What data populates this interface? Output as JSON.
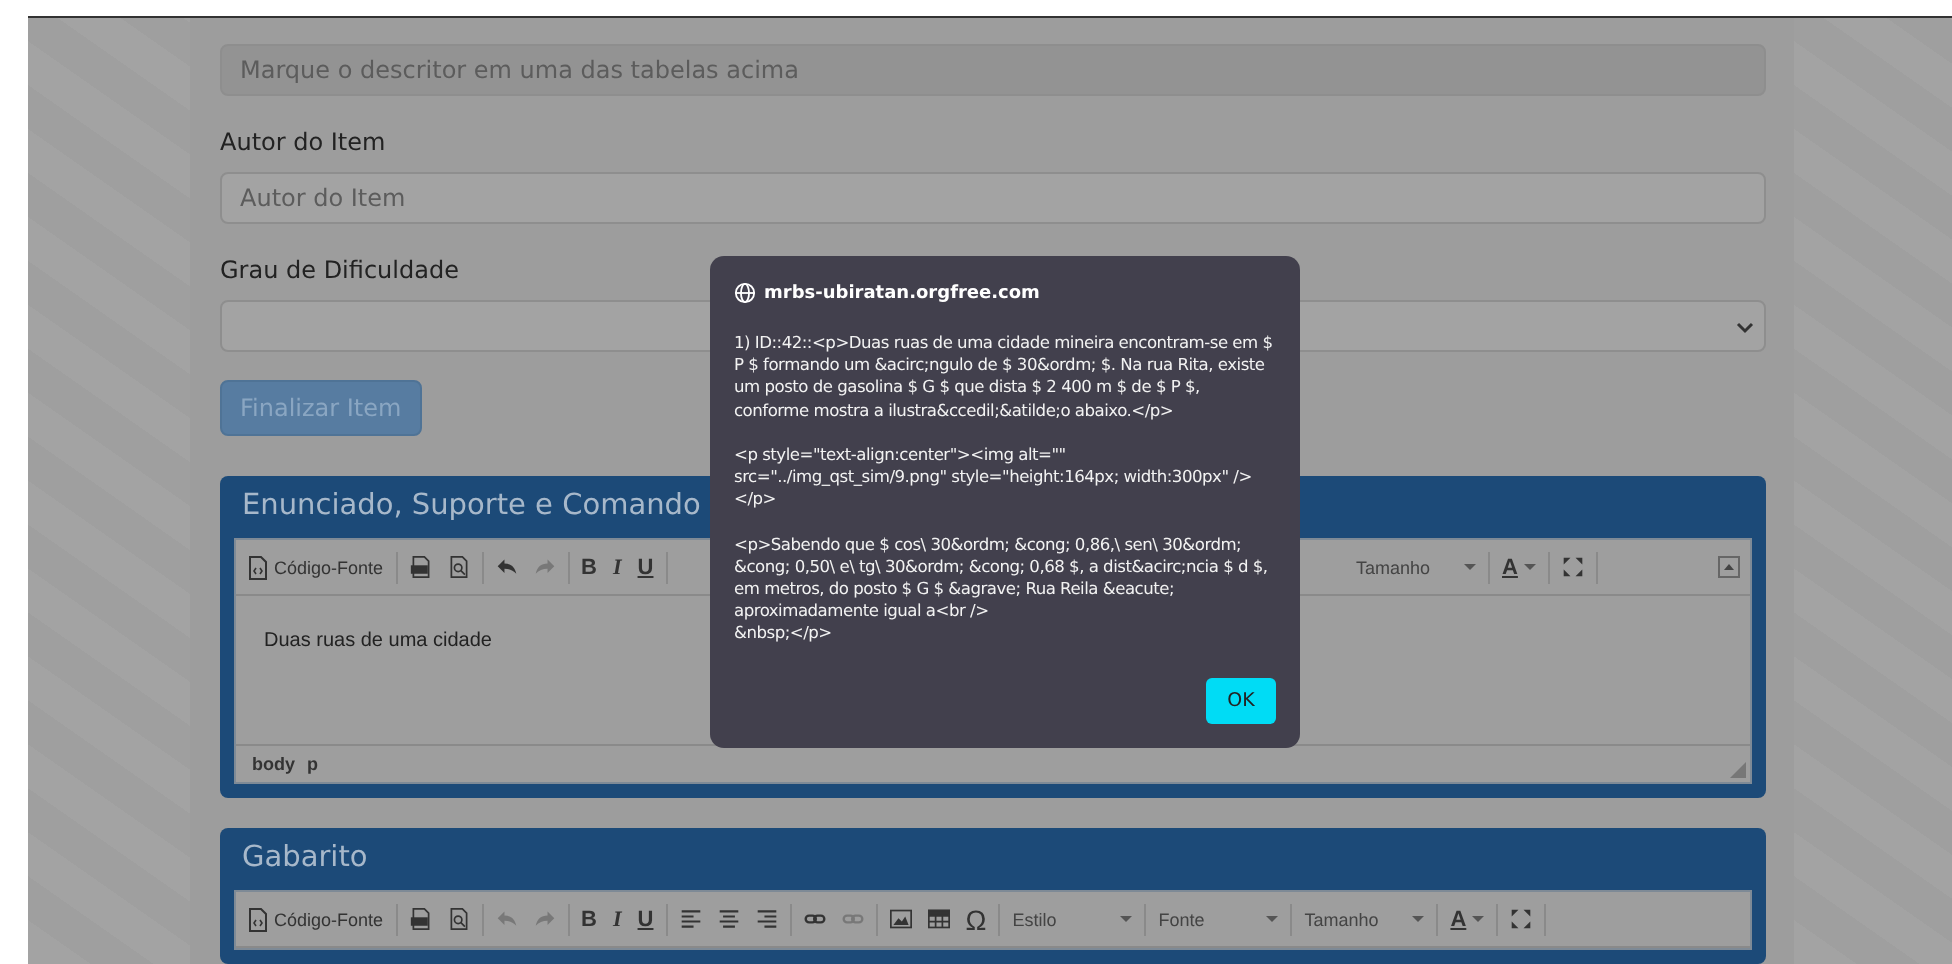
{
  "descriptor_field": {
    "placeholder": "Marque o descritor em uma das tabelas acima",
    "disabled": true
  },
  "author": {
    "label": "Autor do Item",
    "placeholder": "Autor do Item"
  },
  "difficulty": {
    "label": "Grau de Dificuldade"
  },
  "finalize_button": {
    "label": "Finalizar Item"
  },
  "panels": [
    {
      "title": "Enunciado, Suporte e Comando",
      "toolbar": [
        [
          {
            "kind": "source",
            "label": "Código-Fonte",
            "disabled": false
          }
        ],
        [
          {
            "kind": "pdf",
            "disabled": false
          },
          {
            "kind": "preview",
            "disabled": false
          }
        ],
        [
          {
            "kind": "undo",
            "disabled": false
          },
          {
            "kind": "redo",
            "disabled": true
          }
        ],
        [
          {
            "kind": "format",
            "label": "B",
            "disabled": false
          },
          {
            "kind": "format",
            "label": "I",
            "disabled": false
          },
          {
            "kind": "format",
            "label": "U",
            "disabled": false
          }
        ]
      ],
      "toolbar_right": [
        [
          {
            "kind": "dropdown",
            "label": "Tamanho",
            "disabled": false
          }
        ],
        [
          {
            "kind": "color",
            "label": "A",
            "disabled": false
          }
        ],
        [
          {
            "kind": "maximize",
            "disabled": false
          }
        ]
      ],
      "toolbar_collapsed": false,
      "body_text": "Duas ruas de uma cidade",
      "path": [
        "body",
        "p"
      ]
    },
    {
      "title": "Gabarito",
      "toolbar": [
        [
          {
            "kind": "source",
            "label": "Código-Fonte",
            "disabled": false
          }
        ],
        [
          {
            "kind": "pdf",
            "disabled": false
          },
          {
            "kind": "preview",
            "disabled": false
          }
        ],
        [
          {
            "kind": "undo",
            "disabled": true
          },
          {
            "kind": "redo",
            "disabled": true
          }
        ],
        [
          {
            "kind": "format",
            "label": "B",
            "disabled": false
          },
          {
            "kind": "format",
            "label": "I",
            "disabled": false
          },
          {
            "kind": "format",
            "label": "U",
            "disabled": false
          }
        ],
        [
          {
            "kind": "align-left",
            "disabled": false
          },
          {
            "kind": "align-center",
            "disabled": false
          },
          {
            "kind": "align-right",
            "disabled": false
          }
        ],
        [
          {
            "kind": "link",
            "disabled": false
          },
          {
            "kind": "unlink",
            "disabled": true
          }
        ],
        [
          {
            "kind": "image",
            "disabled": false
          },
          {
            "kind": "table",
            "disabled": false
          },
          {
            "kind": "char",
            "label": "Ω",
            "disabled": false
          }
        ],
        [
          {
            "kind": "dropdown",
            "label": "Estilo",
            "disabled": false
          }
        ],
        [
          {
            "kind": "dropdown",
            "label": "Fonte",
            "disabled": false
          }
        ],
        [
          {
            "kind": "dropdown",
            "label": "Tamanho",
            "disabled": false
          }
        ],
        [
          {
            "kind": "color",
            "label": "A",
            "disabled": false
          }
        ],
        [
          {
            "kind": "maximize",
            "disabled": false
          }
        ]
      ]
    }
  ],
  "dialog": {
    "origin": "mrbs-ubiratan.orgfree.com",
    "message": "1) ID::42::<p>Duas ruas de uma cidade mineira encontram-se em $ P $ formando um &acirc;ngulo de $ 30&ordm; $. Na rua Rita, existe um posto de gasolina $ G $ que dista $ 2 400 m $ de $ P $, conforme mostra a ilustra&ccedil;&atilde;o abaixo.</p>\n\n<p style=\"text-align:center\"><img alt=\"\" src=\"../img_qst_sim/9.png\" style=\"height:164px; width:300px\" /></p>\n\n<p>Sabendo que $ cos\\ 30&ordm; &cong; 0,86,\\ sen\\ 30&ordm; &cong; 0,50\\ e\\ tg\\ 30&ordm; &cong; 0,68 $, a dist&acirc;ncia $ d $, em metros, do posto $ G $ &agrave; Rua Reila &eacute; aproximadamente igual a<br />\n&nbsp;</p>",
    "ok_button": "OK"
  }
}
